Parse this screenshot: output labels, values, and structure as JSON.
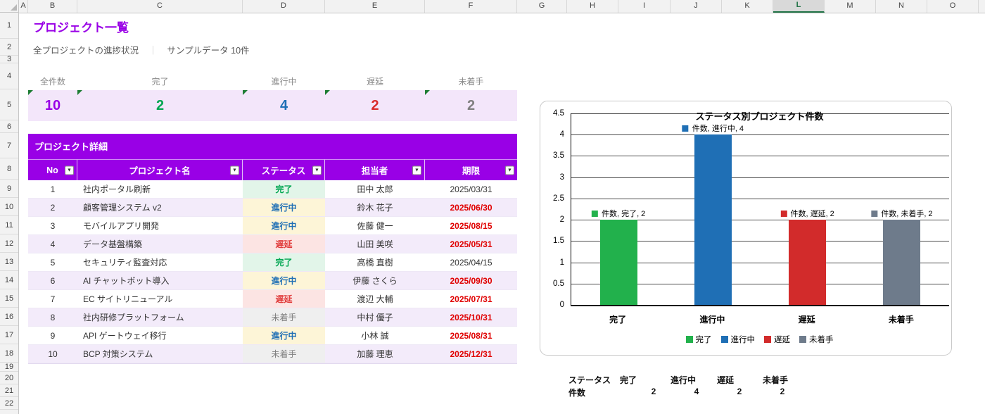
{
  "sheet": {
    "columns": [
      "A",
      "B",
      "C",
      "D",
      "E",
      "F",
      "G",
      "H",
      "I",
      "J",
      "K",
      "L",
      "M",
      "N",
      "O"
    ],
    "selected_column": "L",
    "rows": [
      "1",
      "2",
      "3",
      "4",
      "5",
      "6",
      "7",
      "8",
      "9",
      "10",
      "11",
      "12",
      "13",
      "14",
      "15",
      "16",
      "17",
      "18",
      "19",
      "20",
      "21",
      "22"
    ]
  },
  "header": {
    "title": "プロジェクト一覧",
    "subtitle_left": "全プロジェクトの進捗状況",
    "subtitle_divider": "｜",
    "subtitle_right": "サンプルデータ 10件"
  },
  "kpis": [
    {
      "label": "全件数",
      "value": "10",
      "color": "#9900e6"
    },
    {
      "label": "完了",
      "value": "2",
      "color": "#00a651"
    },
    {
      "label": "進行中",
      "value": "4",
      "color": "#1f6fb5"
    },
    {
      "label": "遅延",
      "value": "2",
      "color": "#d92b2b"
    },
    {
      "label": "未着手",
      "value": "2",
      "color": "#7f7f7f"
    }
  ],
  "table": {
    "section_title": "プロジェクト詳細",
    "columns": [
      "No",
      "プロジェクト名",
      "ステータス",
      "担当者",
      "期限"
    ],
    "rows": [
      {
        "no": "1",
        "name": "社内ポータル刷新",
        "status": "完了",
        "owner": "田中 太郎",
        "deadline": "2025/03/31",
        "overdue": false
      },
      {
        "no": "2",
        "name": "顧客管理システム v2",
        "status": "進行中",
        "owner": "鈴木 花子",
        "deadline": "2025/06/30",
        "overdue": true
      },
      {
        "no": "3",
        "name": "モバイルアプリ開発",
        "status": "進行中",
        "owner": "佐藤 健一",
        "deadline": "2025/08/15",
        "overdue": true
      },
      {
        "no": "4",
        "name": "データ基盤構築",
        "status": "遅延",
        "owner": "山田 美咲",
        "deadline": "2025/05/31",
        "overdue": true
      },
      {
        "no": "5",
        "name": "セキュリティ監査対応",
        "status": "完了",
        "owner": "高橋 直樹",
        "deadline": "2025/04/15",
        "overdue": false
      },
      {
        "no": "6",
        "name": "AI チャットボット導入",
        "status": "進行中",
        "owner": "伊藤 さくら",
        "deadline": "2025/09/30",
        "overdue": true
      },
      {
        "no": "7",
        "name": "EC サイトリニューアル",
        "status": "遅延",
        "owner": "渡辺 大輔",
        "deadline": "2025/07/31",
        "overdue": true
      },
      {
        "no": "8",
        "name": "社内研修プラットフォーム",
        "status": "未着手",
        "owner": "中村 優子",
        "deadline": "2025/10/31",
        "overdue": true
      },
      {
        "no": "9",
        "name": "API ゲートウェイ移行",
        "status": "進行中",
        "owner": "小林 誠",
        "deadline": "2025/08/31",
        "overdue": true
      },
      {
        "no": "10",
        "name": "BCP 対策システム",
        "status": "未着手",
        "owner": "加藤 理恵",
        "deadline": "2025/12/31",
        "overdue": true
      }
    ]
  },
  "status_styles": {
    "完了": {
      "bg": "#e2f5e9",
      "color": "#00a651",
      "bold": true
    },
    "進行中": {
      "bg": "#fdf5d7",
      "color": "#1f6fb5",
      "bold": true
    },
    "遅延": {
      "bg": "#fce4e3",
      "color": "#e03a3a",
      "bold": true
    },
    "未着手": {
      "bg": "#efefef",
      "color": "#7f7f7f",
      "bold": false
    }
  },
  "chart_data": {
    "type": "bar",
    "title": "ステータス別プロジェクト件数",
    "categories": [
      "完了",
      "進行中",
      "遅延",
      "未着手"
    ],
    "series": [
      {
        "name": "件数",
        "values": [
          2,
          4,
          2,
          2
        ]
      }
    ],
    "bar_colors": [
      "#22b14c",
      "#1f6fb5",
      "#d22b2b",
      "#6e7b8b"
    ],
    "ylim": [
      0,
      4.5
    ],
    "ytick_step": 0.5,
    "grid": true,
    "legend_position": "bottom",
    "legend_entries": [
      "完了",
      "進行中",
      "遅延",
      "未着手"
    ],
    "data_labels": [
      "件数, 完了, 2",
      "件数, 進行中, 4",
      "件数, 遅延, 2",
      "件数, 未着手, 2"
    ]
  },
  "summary_table": {
    "status_row": [
      "ステータス",
      "完了",
      "進行中",
      "遅延",
      "未着手"
    ],
    "count_row": [
      "件数",
      "2",
      "4",
      "2",
      "2"
    ]
  },
  "colors": {
    "accent_purple": "#9900e6",
    "kpi_band_bg": "#f3e6fa",
    "alt_row_bg": "#f3ebfa",
    "overdue_red": "#e00000",
    "indicator_green": "#1e7d34"
  }
}
